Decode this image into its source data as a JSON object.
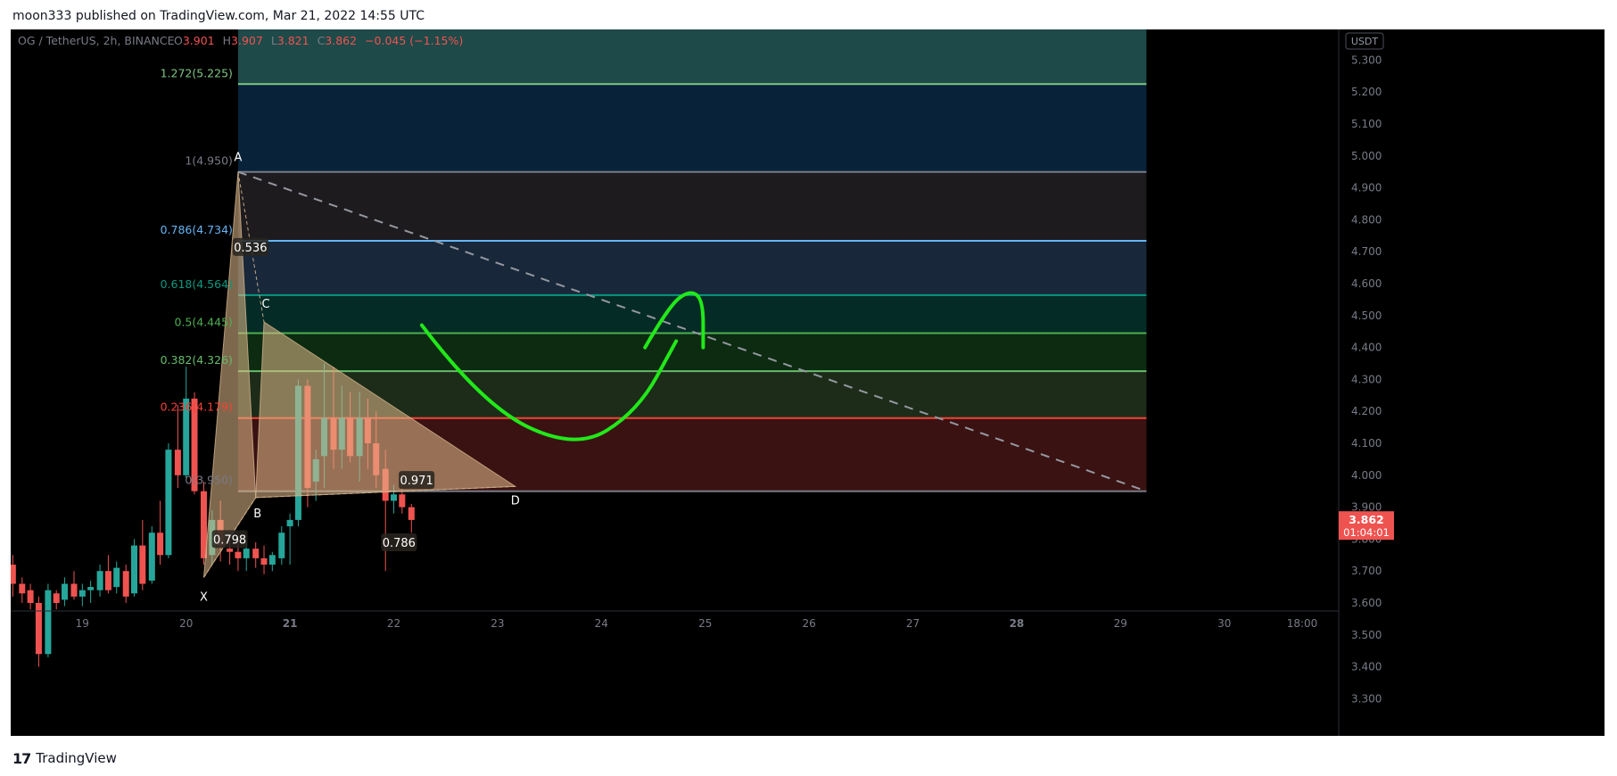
{
  "header": {
    "publisher": "moon333 published on TradingView.com, Mar 21, 2022 14:55 UTC"
  },
  "footer": {
    "logo_glyph": "17",
    "brand": "TradingView"
  },
  "colors": {
    "up": "#26a69a",
    "down": "#ef5350",
    "background": "#000000",
    "drawing": "#22e81a"
  },
  "chart_data": {
    "type": "candlestick",
    "symbol": "OG / TetherUS, 2h, BINANCE",
    "ohlc": {
      "o_label": "O",
      "o": "3.901",
      "h_label": "H",
      "h": "3.907",
      "l_label": "L",
      "l": "3.821",
      "c_label": "C",
      "c": "3.862",
      "change": "−0.045 (−1.15%)"
    },
    "currency_badge": "USDT",
    "ylim": [
      3.25,
      5.35
    ],
    "y_ticks": [
      "3.300",
      "3.400",
      "3.500",
      "3.600",
      "3.700",
      "3.800",
      "3.900",
      "4.000",
      "4.100",
      "4.200",
      "4.300",
      "4.400",
      "4.500",
      "4.600",
      "4.700",
      "4.800",
      "4.900",
      "5.000",
      "5.100",
      "5.200",
      "5.300"
    ],
    "x_ticks": [
      {
        "label": "19",
        "t": 19
      },
      {
        "label": "20",
        "t": 20
      },
      {
        "label": "21",
        "t": 21,
        "bold": true
      },
      {
        "label": "22",
        "t": 22
      },
      {
        "label": "23",
        "t": 23
      },
      {
        "label": "24",
        "t": 24
      },
      {
        "label": "25",
        "t": 25
      },
      {
        "label": "26",
        "t": 26
      },
      {
        "label": "27",
        "t": 27
      },
      {
        "label": "28",
        "t": 28,
        "bold": true
      },
      {
        "label": "29",
        "t": 29
      },
      {
        "label": "30",
        "t": 30
      },
      {
        "label": "18:00",
        "t": 30.75
      }
    ],
    "xlim": [
      18.31,
      30.86
    ],
    "price_label": {
      "price": "3.862",
      "countdown": "01:04:01",
      "value": 3.862
    },
    "fib_levels": [
      {
        "ratio": "1.272",
        "price": "5.225",
        "value": 5.225,
        "color": "#81c784",
        "band_above": "#1e4a49"
      },
      {
        "ratio": "1",
        "price": "4.950",
        "value": 4.95,
        "color": "#787b86",
        "band_above": "#082239"
      },
      {
        "ratio": "0.786",
        "price": "4.734",
        "value": 4.734,
        "color": "#64b5f6",
        "band_above": "#1d1b1e"
      },
      {
        "ratio": "0.618",
        "price": "4.564",
        "value": 4.564,
        "color": "#089981",
        "band_above": "#18283a"
      },
      {
        "ratio": "0.5",
        "price": "4.445",
        "value": 4.445,
        "color": "#4caf50",
        "band_above": "#052b26"
      },
      {
        "ratio": "0.382",
        "price": "4.326",
        "value": 4.326,
        "color": "#66bb6a",
        "band_above": "#0c2b11"
      },
      {
        "ratio": "0.236",
        "price": "4.179",
        "value": 4.179,
        "color": "#f44336",
        "band_above": "#1c2c19"
      },
      {
        "ratio": "0",
        "price": "3.950",
        "value": 3.95,
        "color": "#787b86",
        "band_above": "#3a1212"
      }
    ],
    "fib_range": {
      "t0": 20.5,
      "t1": 29.25
    },
    "trend_line": {
      "from": [
        20.5,
        4.95
      ],
      "to": [
        29.25,
        3.95
      ]
    },
    "pattern": {
      "points": [
        {
          "label": "X",
          "t": 20.17,
          "v": 3.68
        },
        {
          "label": "A",
          "t": 20.5,
          "v": 4.95
        },
        {
          "label": "B",
          "t": 20.67,
          "v": 3.93
        },
        {
          "label": "C",
          "t": 20.75,
          "v": 4.48
        },
        {
          "label": "D",
          "t": 23.17,
          "v": 3.965
        }
      ],
      "ratios": [
        {
          "label": "0.798",
          "t": 20.42,
          "v": 3.8
        },
        {
          "label": "0.536",
          "t": 20.62,
          "v": 4.715
        },
        {
          "label": "0.971",
          "t": 22.22,
          "v": 3.985
        },
        {
          "label": "0.786",
          "t": 22.05,
          "v": 3.79
        }
      ]
    },
    "candles": [
      {
        "t": 18.33,
        "o": 3.72,
        "h": 3.75,
        "l": 3.62,
        "c": 3.66
      },
      {
        "t": 18.42,
        "o": 3.66,
        "h": 3.68,
        "l": 3.6,
        "c": 3.63
      },
      {
        "t": 18.5,
        "o": 3.64,
        "h": 3.66,
        "l": 3.58,
        "c": 3.6
      },
      {
        "t": 18.58,
        "o": 3.6,
        "h": 3.62,
        "l": 3.4,
        "c": 3.44
      },
      {
        "t": 18.67,
        "o": 3.44,
        "h": 3.66,
        "l": 3.43,
        "c": 3.64
      },
      {
        "t": 18.75,
        "o": 3.63,
        "h": 3.64,
        "l": 3.58,
        "c": 3.6
      },
      {
        "t": 18.83,
        "o": 3.61,
        "h": 3.68,
        "l": 3.59,
        "c": 3.66
      },
      {
        "t": 18.92,
        "o": 3.66,
        "h": 3.7,
        "l": 3.61,
        "c": 3.62
      },
      {
        "t": 19.0,
        "o": 3.62,
        "h": 3.66,
        "l": 3.59,
        "c": 3.64
      },
      {
        "t": 19.08,
        "o": 3.64,
        "h": 3.67,
        "l": 3.6,
        "c": 3.65
      },
      {
        "t": 19.17,
        "o": 3.64,
        "h": 3.72,
        "l": 3.62,
        "c": 3.7
      },
      {
        "t": 19.25,
        "o": 3.7,
        "h": 3.75,
        "l": 3.63,
        "c": 3.64
      },
      {
        "t": 19.33,
        "o": 3.65,
        "h": 3.73,
        "l": 3.63,
        "c": 3.71
      },
      {
        "t": 19.42,
        "o": 3.7,
        "h": 3.72,
        "l": 3.6,
        "c": 3.62
      },
      {
        "t": 19.5,
        "o": 3.63,
        "h": 3.8,
        "l": 3.62,
        "c": 3.78
      },
      {
        "t": 19.58,
        "o": 3.78,
        "h": 3.86,
        "l": 3.64,
        "c": 3.66
      },
      {
        "t": 19.67,
        "o": 3.67,
        "h": 3.84,
        "l": 3.66,
        "c": 3.82
      },
      {
        "t": 19.75,
        "o": 3.82,
        "h": 3.92,
        "l": 3.72,
        "c": 3.75
      },
      {
        "t": 19.83,
        "o": 3.75,
        "h": 4.1,
        "l": 3.74,
        "c": 4.08
      },
      {
        "t": 19.92,
        "o": 4.08,
        "h": 4.22,
        "l": 3.96,
        "c": 4.0
      },
      {
        "t": 20.0,
        "o": 4.0,
        "h": 4.34,
        "l": 3.99,
        "c": 4.24
      },
      {
        "t": 20.08,
        "o": 4.24,
        "h": 4.26,
        "l": 3.94,
        "c": 3.95
      },
      {
        "t": 20.17,
        "o": 3.95,
        "h": 3.98,
        "l": 3.72,
        "c": 3.74
      },
      {
        "t": 20.25,
        "o": 3.75,
        "h": 3.89,
        "l": 3.72,
        "c": 3.86
      },
      {
        "t": 20.33,
        "o": 3.86,
        "h": 3.92,
        "l": 3.73,
        "c": 3.78
      },
      {
        "t": 20.42,
        "o": 3.77,
        "h": 3.8,
        "l": 3.72,
        "c": 3.76
      },
      {
        "t": 20.5,
        "o": 3.76,
        "h": 3.8,
        "l": 3.7,
        "c": 3.74
      },
      {
        "t": 20.58,
        "o": 3.74,
        "h": 3.79,
        "l": 3.7,
        "c": 3.77
      },
      {
        "t": 20.67,
        "o": 3.77,
        "h": 3.79,
        "l": 3.71,
        "c": 3.74
      },
      {
        "t": 20.75,
        "o": 3.74,
        "h": 3.78,
        "l": 3.69,
        "c": 3.72
      },
      {
        "t": 20.83,
        "o": 3.72,
        "h": 3.76,
        "l": 3.7,
        "c": 3.75
      },
      {
        "t": 20.92,
        "o": 3.74,
        "h": 3.84,
        "l": 3.72,
        "c": 3.82
      },
      {
        "t": 21.0,
        "o": 3.84,
        "h": 3.88,
        "l": 3.72,
        "c": 3.86
      },
      {
        "t": 21.08,
        "o": 3.86,
        "h": 4.3,
        "l": 3.84,
        "c": 4.28
      },
      {
        "t": 21.17,
        "o": 4.28,
        "h": 4.3,
        "l": 3.9,
        "c": 3.96
      },
      {
        "t": 21.25,
        "o": 3.98,
        "h": 4.08,
        "l": 3.92,
        "c": 4.05
      },
      {
        "t": 21.33,
        "o": 4.06,
        "h": 4.35,
        "l": 3.96,
        "c": 4.18
      },
      {
        "t": 21.42,
        "o": 4.18,
        "h": 4.34,
        "l": 4.02,
        "c": 4.08
      },
      {
        "t": 21.5,
        "o": 4.08,
        "h": 4.28,
        "l": 4.02,
        "c": 4.18
      },
      {
        "t": 21.58,
        "o": 4.18,
        "h": 4.26,
        "l": 4.04,
        "c": 4.06
      },
      {
        "t": 21.67,
        "o": 4.06,
        "h": 4.26,
        "l": 3.98,
        "c": 4.18
      },
      {
        "t": 21.75,
        "o": 4.18,
        "h": 4.24,
        "l": 4.02,
        "c": 4.1
      },
      {
        "t": 21.83,
        "o": 4.1,
        "h": 4.2,
        "l": 3.96,
        "c": 4.0
      },
      {
        "t": 21.92,
        "o": 4.02,
        "h": 4.08,
        "l": 3.7,
        "c": 3.92
      },
      {
        "t": 22.0,
        "o": 3.92,
        "h": 3.97,
        "l": 3.88,
        "c": 3.94
      },
      {
        "t": 22.08,
        "o": 3.94,
        "h": 3.98,
        "l": 3.88,
        "c": 3.9
      },
      {
        "t": 22.17,
        "o": 3.9,
        "h": 3.91,
        "l": 3.82,
        "c": 3.86
      }
    ],
    "hand_drawing": {
      "arc": [
        [
          22.27,
          4.47
        ],
        [
          22.85,
          4.22
        ],
        [
          23.75,
          4.08
        ],
        [
          24.35,
          4.2
        ],
        [
          24.72,
          4.42
        ]
      ],
      "hook": [
        [
          24.42,
          4.4
        ],
        [
          24.65,
          4.53
        ],
        [
          24.85,
          4.58
        ],
        [
          24.98,
          4.55
        ],
        [
          24.98,
          4.4
        ]
      ]
    }
  }
}
